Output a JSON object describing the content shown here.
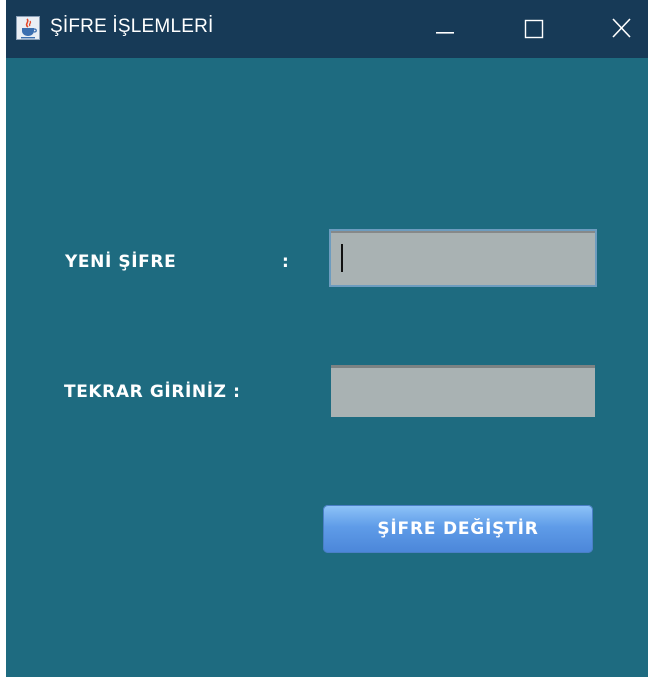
{
  "window": {
    "title": "ŞİFRE İŞLEMLERİ",
    "icon": "java-cup-icon"
  },
  "form": {
    "new_password_label": "YENİ ŞİFRE",
    "new_password_colon": ":",
    "new_password_value": "",
    "repeat_label": "TEKRAR GİRİNİZ :",
    "repeat_value": "",
    "submit_label": "ŞİFRE DEĞİŞTİR"
  },
  "colors": {
    "window_background": "#1e6b80",
    "titlebar": "#173a57",
    "field_background": "#a9b2b3",
    "button_accent": "#5f9ce8"
  }
}
